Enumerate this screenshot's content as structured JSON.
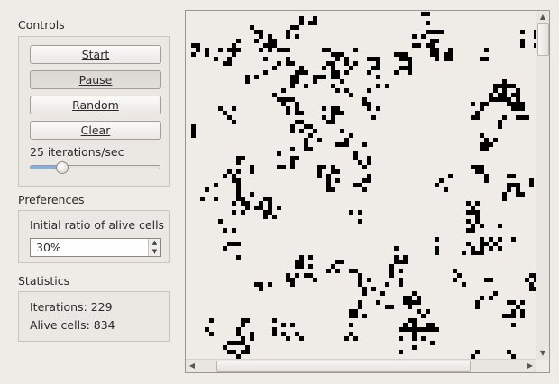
{
  "controls": {
    "title": "Controls",
    "start_label": "Start",
    "pause_label": "Pause",
    "random_label": "Random",
    "clear_label": "Clear",
    "speed_text": "25 iterations/sec",
    "speed_fraction": 0.25
  },
  "preferences": {
    "title": "Preferences",
    "ratio_label": "Initial ratio of alive cells",
    "ratio_value": "30%"
  },
  "statistics": {
    "title": "Statistics",
    "iterations_text": "Iterations: 229",
    "alive_text": "Alive cells: 834"
  },
  "colors": {
    "alive": "#000000",
    "dead": "#efebe7"
  },
  "icons": {
    "scroll_up": "up-arrow-icon",
    "scroll_down": "down-arrow-icon",
    "scroll_left": "left-arrow-icon",
    "scroll_right": "right-arrow-icon"
  }
}
